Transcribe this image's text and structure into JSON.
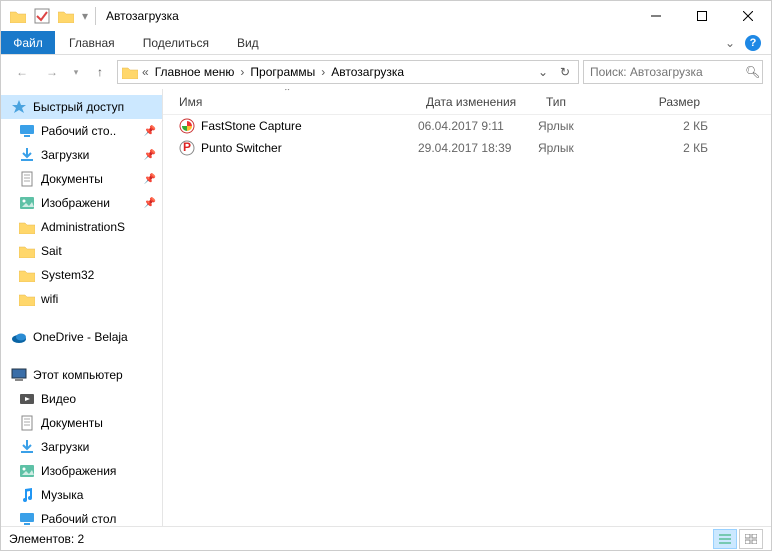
{
  "titlebar": {
    "title": "Автозагрузка"
  },
  "ribbon": {
    "file": "Файл",
    "tabs": [
      "Главная",
      "Поделиться",
      "Вид"
    ]
  },
  "breadcrumbs": [
    "Главное меню",
    "Программы",
    "Автозагрузка"
  ],
  "search": {
    "placeholder": "Поиск: Автозагрузка"
  },
  "sidebar": {
    "quick": "Быстрый доступ",
    "pinned": [
      {
        "label": "Рабочий сто..",
        "icon": "desktop"
      },
      {
        "label": "Загрузки",
        "icon": "downloads"
      },
      {
        "label": "Документы",
        "icon": "documents"
      },
      {
        "label": "Изображени",
        "icon": "pictures"
      }
    ],
    "folders": [
      "AdministrationS",
      "Sait",
      "System32",
      "wifi"
    ],
    "onedrive": "OneDrive - Belaja",
    "thispc": "Этот компьютер",
    "pcitems": [
      {
        "label": "Видео",
        "icon": "video"
      },
      {
        "label": "Документы",
        "icon": "documents"
      },
      {
        "label": "Загрузки",
        "icon": "downloads"
      },
      {
        "label": "Изображения",
        "icon": "pictures"
      },
      {
        "label": "Музыка",
        "icon": "music"
      },
      {
        "label": "Рабочий стол",
        "icon": "desktop"
      }
    ]
  },
  "columns": {
    "name": "Имя",
    "date": "Дата изменения",
    "type": "Тип",
    "size": "Размер"
  },
  "files": [
    {
      "name": "FastStone Capture",
      "date": "06.04.2017 9:11",
      "type": "Ярлык",
      "size": "2 КБ",
      "icon": "fsc"
    },
    {
      "name": "Punto Switcher",
      "date": "29.04.2017 18:39",
      "type": "Ярлык",
      "size": "2 КБ",
      "icon": "punto"
    }
  ],
  "status": {
    "text": "Элементов: 2"
  }
}
